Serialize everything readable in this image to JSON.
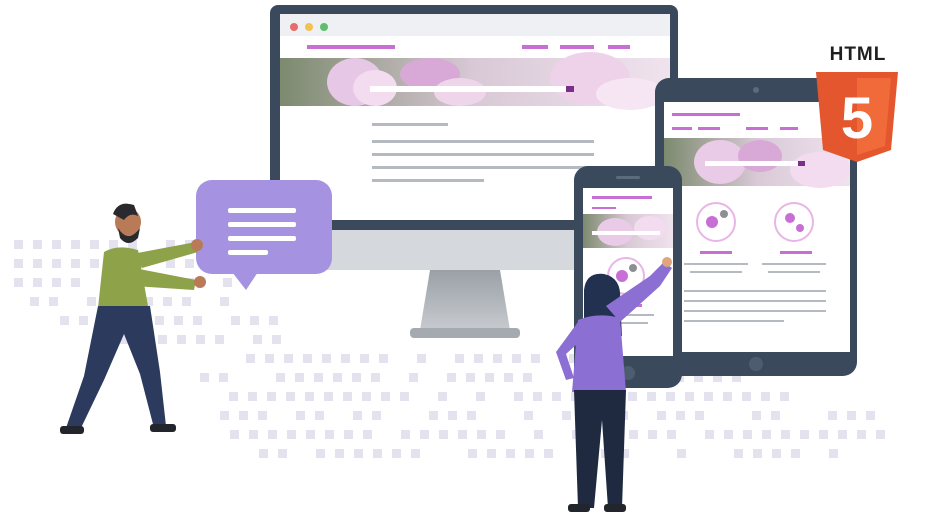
{
  "illustration": {
    "badge": {
      "text": "HTML",
      "number": "5",
      "icon": "html5-shield-icon"
    },
    "colors": {
      "device_frame": "#3a4a5c",
      "accent": "#c86fd6",
      "bubble": "#a592e0",
      "html5_orange": "#e4572e",
      "html5_dark": "#c4401a",
      "dots": "#e3e2ee",
      "text_lines": "#b5b9c0"
    },
    "devices": [
      "desktop-monitor",
      "tablet",
      "smartphone"
    ],
    "people": [
      "man-holding-speech-bubble",
      "woman-pointing-at-phone"
    ]
  }
}
